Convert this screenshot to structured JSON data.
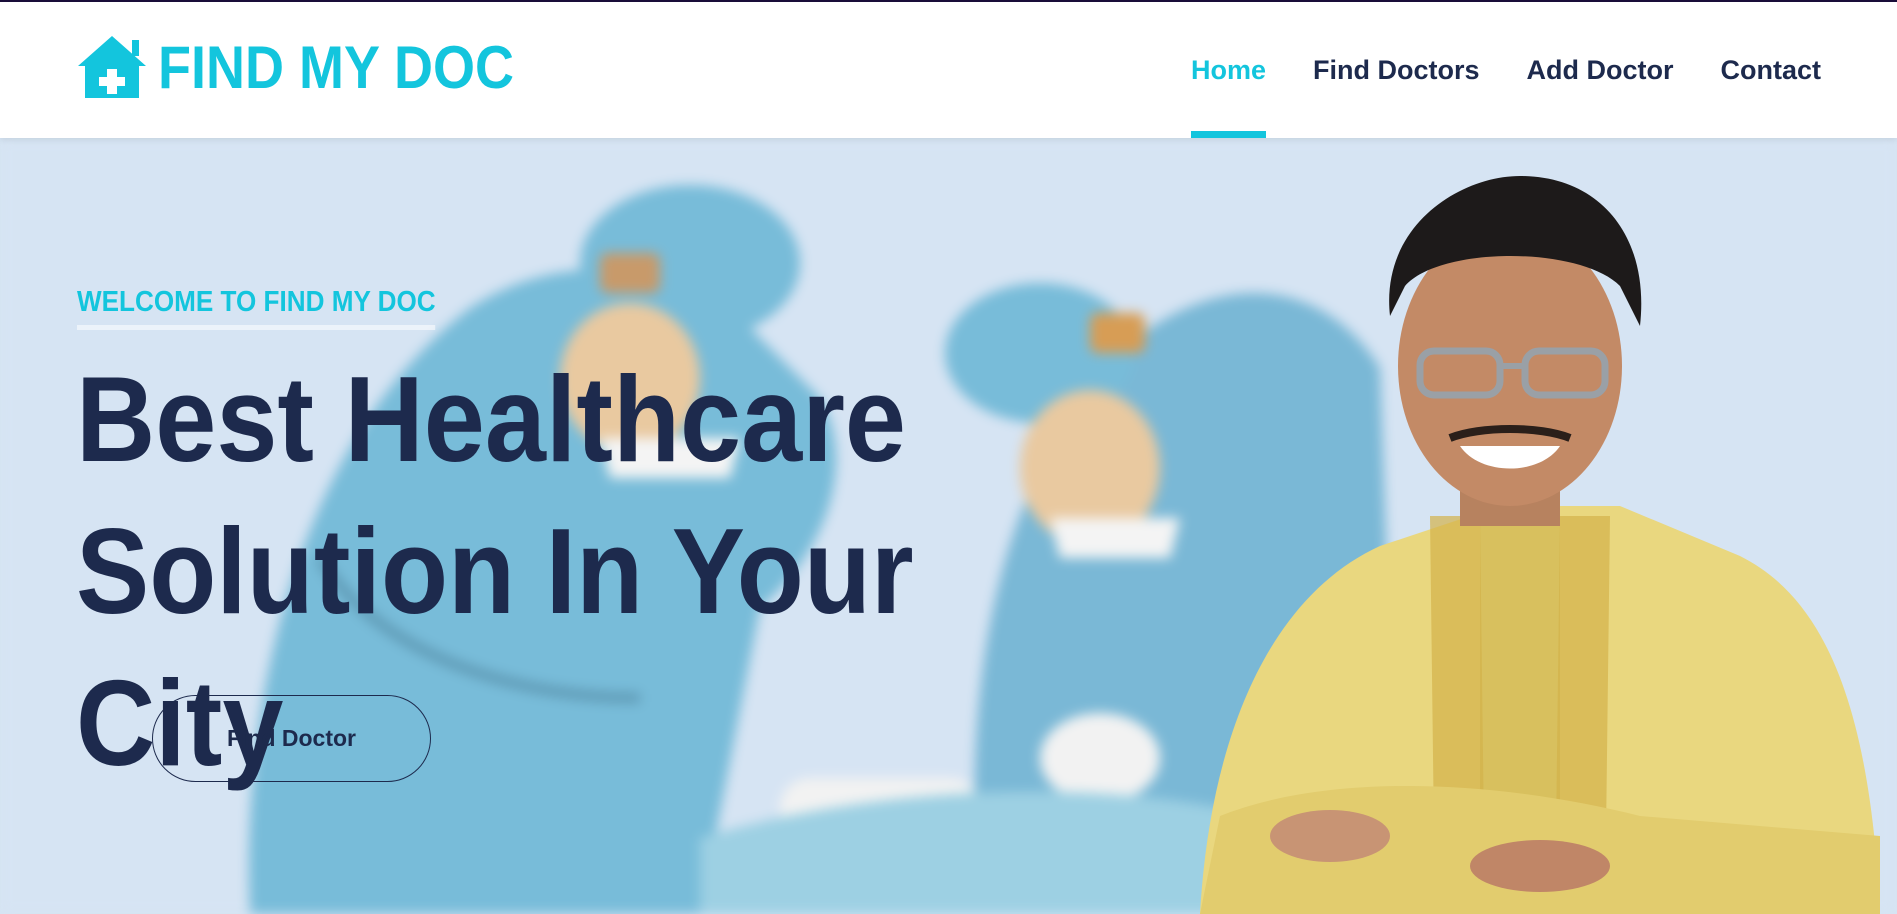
{
  "brand": {
    "name": "FIND MY DOC",
    "icon": "house-medical-icon",
    "color": "#13c5dd"
  },
  "nav": {
    "items": [
      {
        "label": "Home",
        "active": true
      },
      {
        "label": "Find Doctors",
        "active": false
      },
      {
        "label": "Add Doctor",
        "active": false
      },
      {
        "label": "Contact",
        "active": false
      }
    ]
  },
  "hero": {
    "eyebrow": "WELCOME TO FIND MY DOC",
    "title_line1": "Best Healthcare",
    "title_line2": "Solution In Your City",
    "cta_label": "Find Doctor",
    "background": "blurred-surgeons-illustration",
    "person_image": "smiling-man-in-yellow-kurta"
  },
  "colors": {
    "accent": "#13c5dd",
    "navy": "#1d2a4d",
    "hero_bg": "#d6e4f3"
  }
}
